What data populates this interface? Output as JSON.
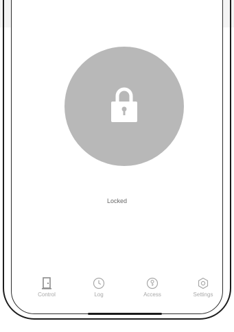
{
  "status": {
    "lock_state": "Locked"
  },
  "lock_button": {
    "icon": "padlock-icon",
    "color": "#b8b8b8"
  },
  "tabs": [
    {
      "label": "Control",
      "icon": "door-icon"
    },
    {
      "label": "Log",
      "icon": "clock-icon"
    },
    {
      "label": "Access",
      "icon": "key-circle-icon"
    },
    {
      "label": "Settings",
      "icon": "gear-icon"
    }
  ],
  "colors": {
    "tab_inactive": "#a8a8a8",
    "frame": "#1c1c1c"
  }
}
